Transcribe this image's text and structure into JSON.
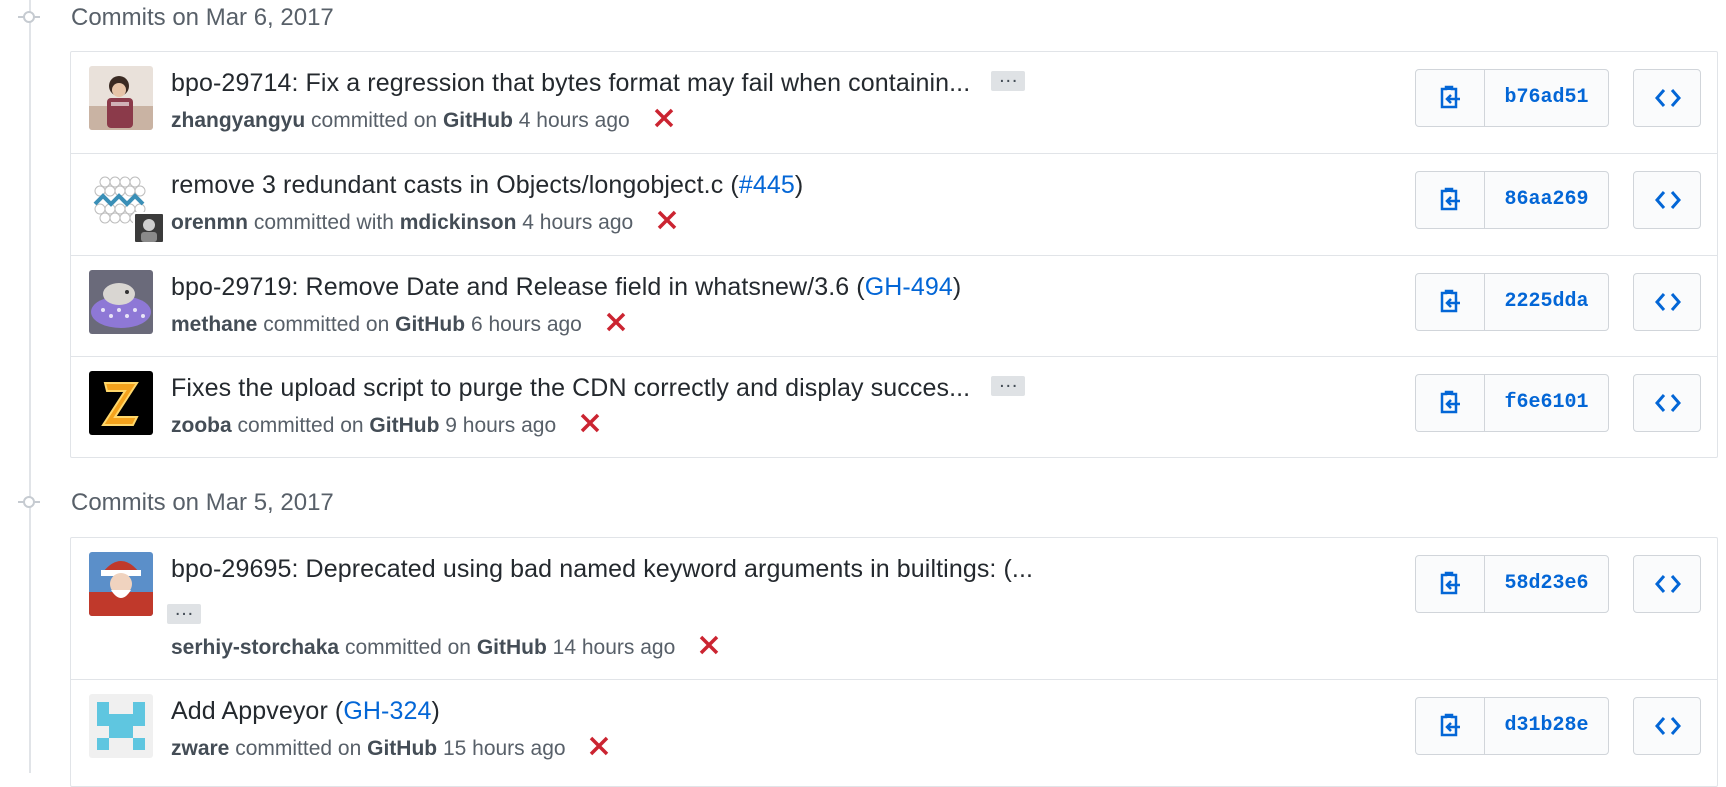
{
  "groups": [
    {
      "title": "Commits on Mar 6, 2017",
      "commits": [
        {
          "message": "bpo-29714: Fix a regression that bytes format may fail when containin...",
          "issue": "",
          "has_ellipsis": true,
          "author": "zhangyangyu",
          "verb": "committed on",
          "committer": "GitHub",
          "time": "4 hours ago",
          "sha": "b76ad51",
          "avatar_colors": [
            "#8b3a4a",
            "#d8c6b8"
          ]
        },
        {
          "message": "remove 3 redundant casts in Objects/longobject.c",
          "issue": "#445",
          "has_ellipsis": false,
          "author": "orenmn",
          "verb": "committed with",
          "committer": "mdickinson",
          "time": "4 hours ago",
          "sha": "86aa269",
          "avatar_colors": [
            "#d0d0d0",
            "#3a8fb7"
          ]
        },
        {
          "message": "bpo-29719: Remove Date and Release field in whatsnew/3.6",
          "issue": "GH-494",
          "has_ellipsis": false,
          "author": "methane",
          "verb": "committed on",
          "committer": "GitHub",
          "time": "6 hours ago",
          "sha": "2225dda",
          "avatar_colors": [
            "#7b68c9",
            "#cfcfe0"
          ]
        },
        {
          "message": "Fixes the upload script to purge the CDN correctly and display succes...",
          "issue": "",
          "has_ellipsis": true,
          "author": "zooba",
          "verb": "committed on",
          "committer": "GitHub",
          "time": "9 hours ago",
          "sha": "f6e6101",
          "avatar_colors": [
            "#000000",
            "#f4a21c"
          ]
        }
      ]
    },
    {
      "title": "Commits on Mar 5, 2017",
      "commits": [
        {
          "message": "bpo-29695: Deprecated using bad named keyword arguments in builtings: (...",
          "issue": "",
          "has_ellipsis": true,
          "author": "serhiy-storchaka",
          "verb": "committed on",
          "committer": "GitHub",
          "time": "14 hours ago",
          "sha": "58d23e6",
          "avatar_colors": [
            "#c0392b",
            "#5b8fc9"
          ]
        },
        {
          "message": "Add Appveyor",
          "issue": "GH-324",
          "has_ellipsis": false,
          "author": "zware",
          "verb": "committed on",
          "committer": "GitHub",
          "time": "15 hours ago",
          "sha": "d31b28e",
          "avatar_colors": [
            "#f0f0f0",
            "#5fc6e0"
          ]
        }
      ]
    }
  ],
  "colors": {
    "link": "#0366d6",
    "status_failure": "#cb2431",
    "border": "#e1e4e8",
    "muted_text": "#586069"
  },
  "icons": {
    "status": "x-icon",
    "copy": "clippy-icon",
    "browse": "code-icon",
    "timeline": "git-commit-icon"
  }
}
